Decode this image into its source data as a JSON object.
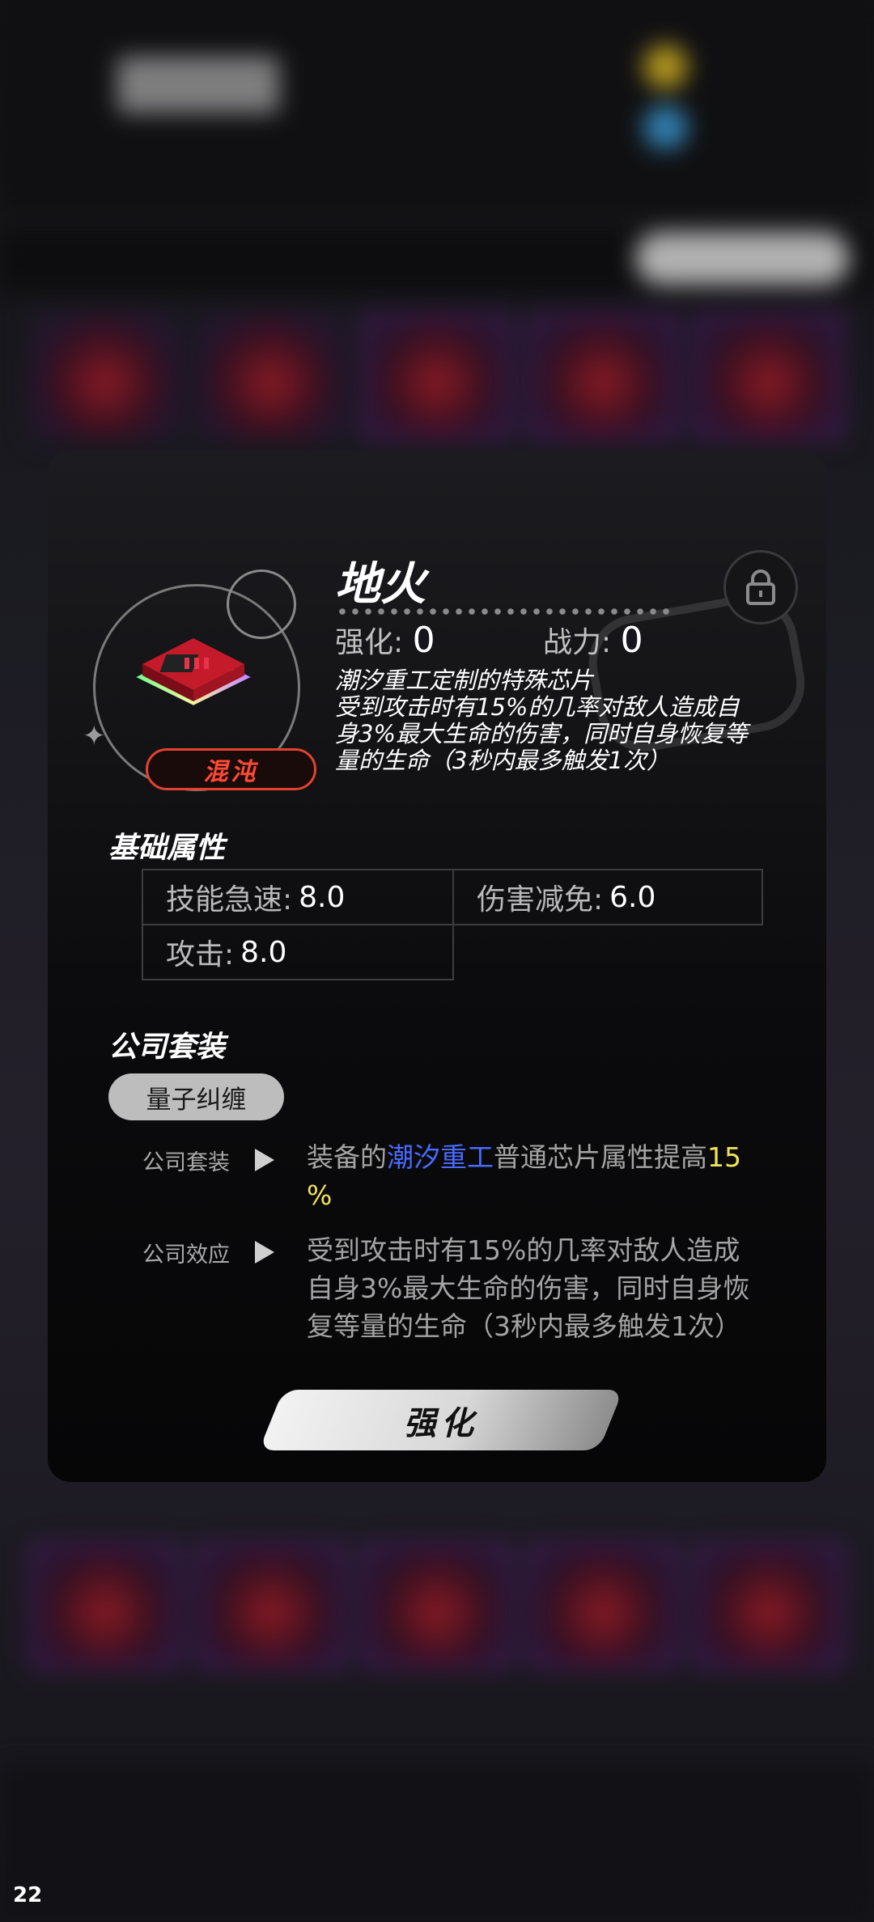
{
  "item": {
    "name": "地火",
    "rarity": "混沌",
    "enhance_label": "强化:",
    "enhance_value": "0",
    "power_label": "战力:",
    "power_value": "0",
    "description_lines": [
      "潮汐重工定制的特殊芯片",
      "受到攻击时有15%的几率对敌人造成自",
      "身3%最大生命的伤害，同时自身恢复等",
      "量的生命（3秒内最多触发1次）"
    ]
  },
  "base_attributes": {
    "title": "基础属性",
    "rows": [
      {
        "label": "技能急速:",
        "value": "8.0"
      },
      {
        "label": "伤害减免:",
        "value": "6.0"
      },
      {
        "label": "攻击:",
        "value": "8.0"
      }
    ]
  },
  "company_set": {
    "title": "公司套装",
    "set_name": "量子纠缠",
    "set_bonus": {
      "label": "公司套装",
      "pre": "装备的",
      "company": "潮汐重工",
      "mid": "普通芯片属性提高",
      "percent_a": "15",
      "percent_b": "%"
    },
    "set_effect": {
      "label": "公司效应",
      "lines": [
        "受到攻击时有15%的几率对敌人造成",
        "自身3%最大生命的伤害，同时自身恢",
        "复等量的生命（3秒内最多触发1次）"
      ]
    }
  },
  "actions": {
    "upgrade_label": "强化"
  },
  "corner_number": "22",
  "icons": {
    "lock": "lock-icon",
    "chip": "chip-icon",
    "star": "sparkle-icon",
    "arrow": "play-arrow-icon"
  },
  "colors": {
    "rarity": "#e2432f",
    "highlight_blue": "#4a6bff",
    "highlight_yellow": "#f1e25c"
  }
}
